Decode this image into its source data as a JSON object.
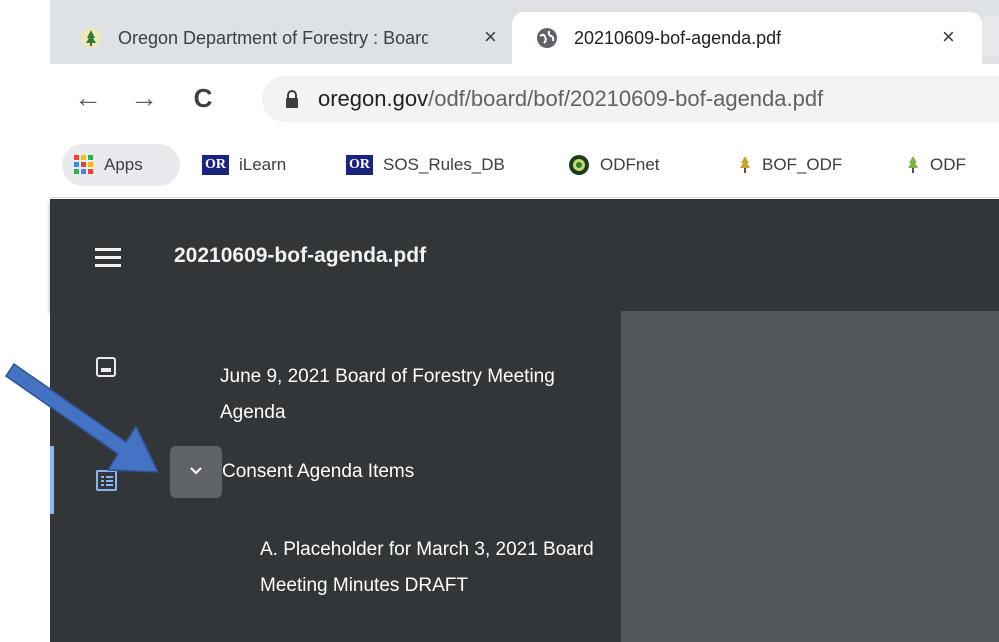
{
  "tabs": [
    {
      "title": "Oregon Department of Forestry : Board of Forestry",
      "favicon": "tree-icon",
      "close": "×"
    },
    {
      "title": "20210609-bof-agenda.pdf",
      "favicon": "globe-icon",
      "close": "×"
    }
  ],
  "toolbar": {
    "back": "←",
    "forward": "→",
    "reload": "C",
    "url_host": "oregon.gov",
    "url_path": "/odf/board/bof/20210609-bof-agenda.pdf"
  },
  "bookmarks": [
    {
      "label": "Apps",
      "icon": "apps-grid-icon"
    },
    {
      "label": "iLearn",
      "icon": "or-logo",
      "logo_text": "OR"
    },
    {
      "label": "SOS_Rules_DB",
      "icon": "or-logo",
      "logo_text": "OR"
    },
    {
      "label": "ODFnet",
      "icon": "odfnet-icon"
    },
    {
      "label": "BOF_ODF",
      "icon": "tree-icon"
    },
    {
      "label": "ODF",
      "icon": "tree-icon"
    }
  ],
  "pdf_viewer": {
    "title": "20210609-bof-agenda.pdf",
    "outline": [
      {
        "label": "June 9, 2021 Board of Forestry Meeting Agenda"
      },
      {
        "label": "Consent Agenda Items",
        "expanded": true
      },
      {
        "label": "A. Placeholder for March 3, 2021 Board Meeting Minutes DRAFT"
      }
    ]
  },
  "colors": {
    "pdf_toolbar": "#323639",
    "pdf_content": "#525659",
    "accent_blue": "#8ab4f8",
    "annotation_arrow": "#4472c4"
  }
}
